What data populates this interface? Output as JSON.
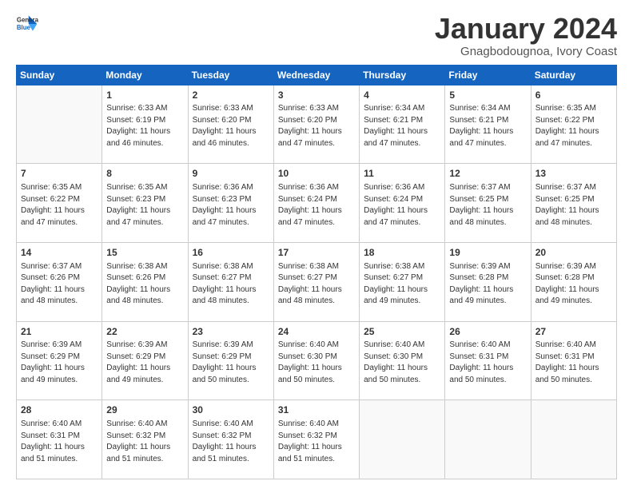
{
  "logo": {
    "line1": "General",
    "line2": "Blue"
  },
  "title": "January 2024",
  "subtitle": "Gnagbodougnoa, Ivory Coast",
  "weekdays": [
    "Sunday",
    "Monday",
    "Tuesday",
    "Wednesday",
    "Thursday",
    "Friday",
    "Saturday"
  ],
  "weeks": [
    [
      {
        "day": "",
        "info": ""
      },
      {
        "day": "1",
        "info": "Sunrise: 6:33 AM\nSunset: 6:19 PM\nDaylight: 11 hours\nand 46 minutes."
      },
      {
        "day": "2",
        "info": "Sunrise: 6:33 AM\nSunset: 6:20 PM\nDaylight: 11 hours\nand 46 minutes."
      },
      {
        "day": "3",
        "info": "Sunrise: 6:33 AM\nSunset: 6:20 PM\nDaylight: 11 hours\nand 47 minutes."
      },
      {
        "day": "4",
        "info": "Sunrise: 6:34 AM\nSunset: 6:21 PM\nDaylight: 11 hours\nand 47 minutes."
      },
      {
        "day": "5",
        "info": "Sunrise: 6:34 AM\nSunset: 6:21 PM\nDaylight: 11 hours\nand 47 minutes."
      },
      {
        "day": "6",
        "info": "Sunrise: 6:35 AM\nSunset: 6:22 PM\nDaylight: 11 hours\nand 47 minutes."
      }
    ],
    [
      {
        "day": "7",
        "info": "Sunrise: 6:35 AM\nSunset: 6:22 PM\nDaylight: 11 hours\nand 47 minutes."
      },
      {
        "day": "8",
        "info": "Sunrise: 6:35 AM\nSunset: 6:23 PM\nDaylight: 11 hours\nand 47 minutes."
      },
      {
        "day": "9",
        "info": "Sunrise: 6:36 AM\nSunset: 6:23 PM\nDaylight: 11 hours\nand 47 minutes."
      },
      {
        "day": "10",
        "info": "Sunrise: 6:36 AM\nSunset: 6:24 PM\nDaylight: 11 hours\nand 47 minutes."
      },
      {
        "day": "11",
        "info": "Sunrise: 6:36 AM\nSunset: 6:24 PM\nDaylight: 11 hours\nand 47 minutes."
      },
      {
        "day": "12",
        "info": "Sunrise: 6:37 AM\nSunset: 6:25 PM\nDaylight: 11 hours\nand 48 minutes."
      },
      {
        "day": "13",
        "info": "Sunrise: 6:37 AM\nSunset: 6:25 PM\nDaylight: 11 hours\nand 48 minutes."
      }
    ],
    [
      {
        "day": "14",
        "info": "Sunrise: 6:37 AM\nSunset: 6:26 PM\nDaylight: 11 hours\nand 48 minutes."
      },
      {
        "day": "15",
        "info": "Sunrise: 6:38 AM\nSunset: 6:26 PM\nDaylight: 11 hours\nand 48 minutes."
      },
      {
        "day": "16",
        "info": "Sunrise: 6:38 AM\nSunset: 6:27 PM\nDaylight: 11 hours\nand 48 minutes."
      },
      {
        "day": "17",
        "info": "Sunrise: 6:38 AM\nSunset: 6:27 PM\nDaylight: 11 hours\nand 48 minutes."
      },
      {
        "day": "18",
        "info": "Sunrise: 6:38 AM\nSunset: 6:27 PM\nDaylight: 11 hours\nand 49 minutes."
      },
      {
        "day": "19",
        "info": "Sunrise: 6:39 AM\nSunset: 6:28 PM\nDaylight: 11 hours\nand 49 minutes."
      },
      {
        "day": "20",
        "info": "Sunrise: 6:39 AM\nSunset: 6:28 PM\nDaylight: 11 hours\nand 49 minutes."
      }
    ],
    [
      {
        "day": "21",
        "info": "Sunrise: 6:39 AM\nSunset: 6:29 PM\nDaylight: 11 hours\nand 49 minutes."
      },
      {
        "day": "22",
        "info": "Sunrise: 6:39 AM\nSunset: 6:29 PM\nDaylight: 11 hours\nand 49 minutes."
      },
      {
        "day": "23",
        "info": "Sunrise: 6:39 AM\nSunset: 6:29 PM\nDaylight: 11 hours\nand 50 minutes."
      },
      {
        "day": "24",
        "info": "Sunrise: 6:40 AM\nSunset: 6:30 PM\nDaylight: 11 hours\nand 50 minutes."
      },
      {
        "day": "25",
        "info": "Sunrise: 6:40 AM\nSunset: 6:30 PM\nDaylight: 11 hours\nand 50 minutes."
      },
      {
        "day": "26",
        "info": "Sunrise: 6:40 AM\nSunset: 6:31 PM\nDaylight: 11 hours\nand 50 minutes."
      },
      {
        "day": "27",
        "info": "Sunrise: 6:40 AM\nSunset: 6:31 PM\nDaylight: 11 hours\nand 50 minutes."
      }
    ],
    [
      {
        "day": "28",
        "info": "Sunrise: 6:40 AM\nSunset: 6:31 PM\nDaylight: 11 hours\nand 51 minutes."
      },
      {
        "day": "29",
        "info": "Sunrise: 6:40 AM\nSunset: 6:32 PM\nDaylight: 11 hours\nand 51 minutes."
      },
      {
        "day": "30",
        "info": "Sunrise: 6:40 AM\nSunset: 6:32 PM\nDaylight: 11 hours\nand 51 minutes."
      },
      {
        "day": "31",
        "info": "Sunrise: 6:40 AM\nSunset: 6:32 PM\nDaylight: 11 hours\nand 51 minutes."
      },
      {
        "day": "",
        "info": ""
      },
      {
        "day": "",
        "info": ""
      },
      {
        "day": "",
        "info": ""
      }
    ]
  ]
}
